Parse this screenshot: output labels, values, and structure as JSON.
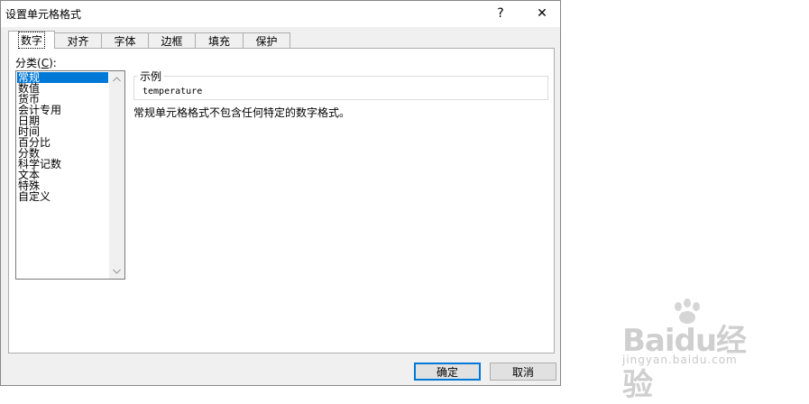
{
  "window": {
    "title": "设置单元格格式",
    "help_label": "?",
    "close_label": "✕"
  },
  "tabs": [
    {
      "label": "数字",
      "active": true
    },
    {
      "label": "对齐",
      "active": false
    },
    {
      "label": "字体",
      "active": false
    },
    {
      "label": "边框",
      "active": false
    },
    {
      "label": "填充",
      "active": false
    },
    {
      "label": "保护",
      "active": false
    }
  ],
  "category": {
    "label_prefix": "分类(",
    "label_key": "C",
    "label_suffix": "):",
    "items": [
      "常规",
      "数值",
      "货币",
      "会计专用",
      "日期",
      "时间",
      "百分比",
      "分数",
      "科学记数",
      "文本",
      "特殊",
      "自定义"
    ],
    "selected_index": 0
  },
  "sample": {
    "legend": "示例",
    "value": "temperature"
  },
  "description": "常规单元格格式不包含任何特定的数字格式。",
  "buttons": {
    "ok": "确定",
    "cancel": "取消"
  },
  "watermark": {
    "logo": "Baidu经验",
    "sub": "jingyan.baidu.com"
  },
  "colors": {
    "selection": "#0078d7",
    "dialog_bg": "#f0f0f0",
    "panel_bg": "#ffffff"
  }
}
